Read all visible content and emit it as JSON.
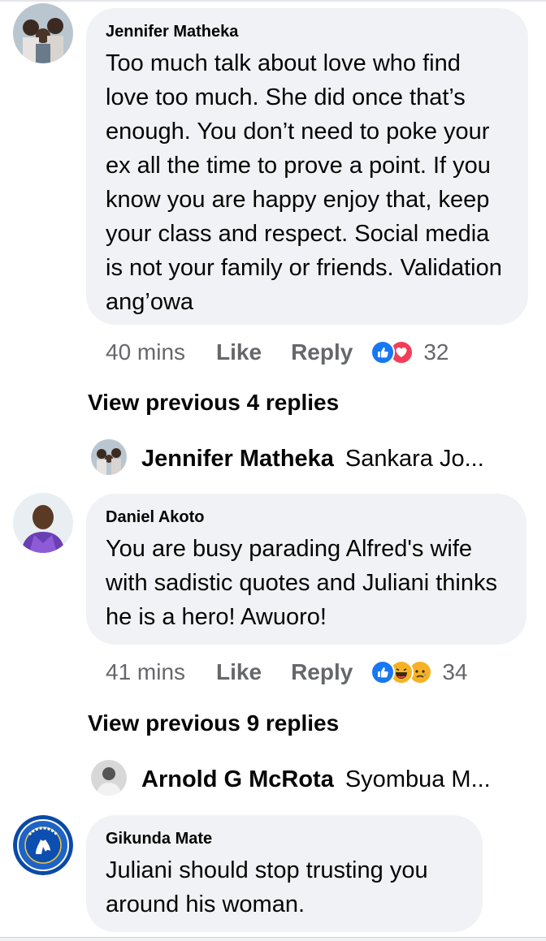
{
  "comments": [
    {
      "author": "Jennifer Matheka",
      "text": "Too much talk about love who find love too much. She did once that’s enough. You don’t need to poke your ex all the time to prove a point. If you know you are happy enjoy that, keep your class and respect. Social media is not your family or friends. Validation ang’owa",
      "time": "40 mins",
      "like_label": "Like",
      "reply_label": "Reply",
      "reactions": [
        "like",
        "love"
      ],
      "reaction_count": "32",
      "view_previous": "View previous 4 replies",
      "latest_reply": {
        "author": "Jennifer Matheka",
        "text": "Sankara Jo..."
      }
    },
    {
      "author": "Daniel Akoto",
      "text": "You are busy parading Alfred's wife with sadistic quotes and Juliani thinks he is a hero! Awuoro!",
      "time": "41 mins",
      "like_label": "Like",
      "reply_label": "Reply",
      "reactions": [
        "like",
        "haha",
        "sad"
      ],
      "reaction_count": "34",
      "view_previous": "View previous 9 replies",
      "latest_reply": {
        "author": "Arnold G McRota",
        "text": "Syombua M..."
      }
    },
    {
      "author": "Gikunda Mate",
      "text": "Juliani should stop trusting you around his woman."
    }
  ],
  "colors": {
    "bubble": "#f0f2f5",
    "secondary_text": "#65676b",
    "like_blue": "#1877f2",
    "love_red": "#f33e58",
    "haha_yellow": "#f7b125"
  }
}
